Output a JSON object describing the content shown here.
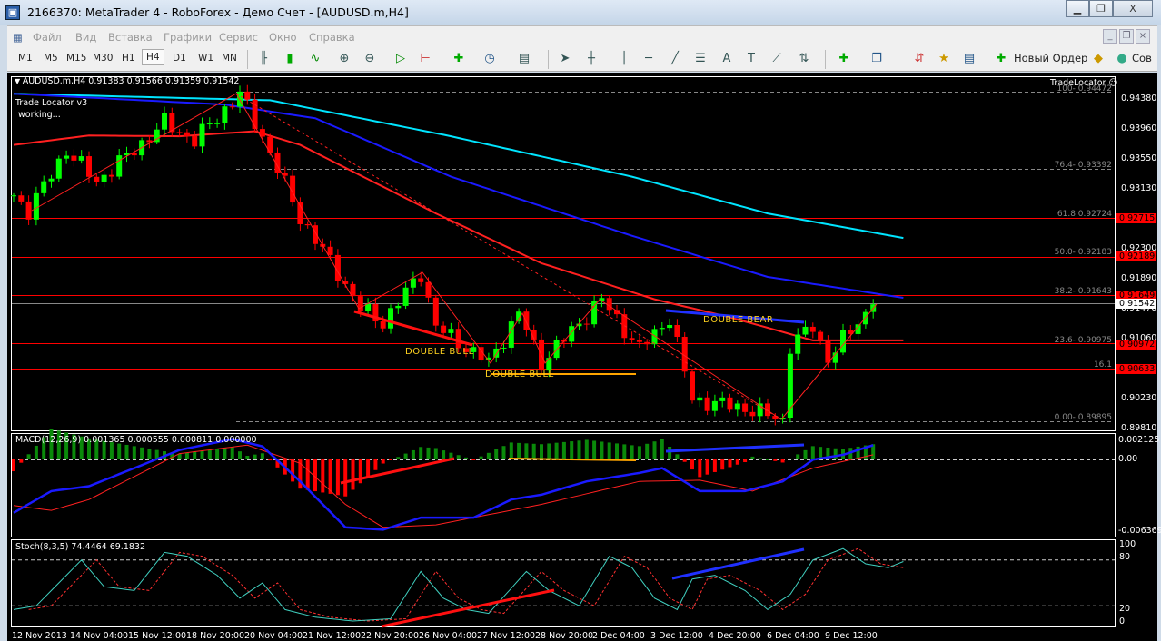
{
  "window": {
    "title": "2166370: MetaTrader 4 - RoboForex - Демо Счет - [AUDUSD.m,H4]",
    "minimize": "▁",
    "restore": "❐",
    "close": "X"
  },
  "menu": [
    "Файл",
    "Вид",
    "Вставка",
    "Графики",
    "Сервис",
    "Окно",
    "Справка"
  ],
  "toolbar": {
    "timeframes": [
      "M1",
      "M5",
      "M15",
      "M30",
      "H1",
      "H4",
      "D1",
      "W1",
      "MN"
    ],
    "selected_timeframe": "H4",
    "new_order": "Новый Ордер",
    "advisors": "Сов"
  },
  "chart": {
    "header": "AUDUSD.m,H4  0.91383 0.91566 0.91359 0.91542",
    "indicator_name": "Trade Locator v3",
    "indicator_status": "working...",
    "trade_locator_label": "TradeLocator ☺",
    "price_ticks": [
      "0.94380",
      "0.93960",
      "0.93550",
      "0.93130",
      "0.92300",
      "0.91890",
      "0.91470",
      "0.91060",
      "0.90230",
      "0.89810"
    ],
    "price_tags": [
      {
        "value": "0.92715",
        "color": "#ff0000"
      },
      {
        "value": "0.92189",
        "color": "#ff0000"
      },
      {
        "value": "0.91649",
        "color": "#ff0000"
      },
      {
        "value": "0.90972",
        "color": "#ff0000"
      },
      {
        "value": "0.90633",
        "color": "#ff0000"
      }
    ],
    "current_price": "0.91542",
    "fibo": [
      {
        "label": "100- 0.94472",
        "price": 0.94472,
        "style": "dash"
      },
      {
        "label": "76.4- 0.93392",
        "price": 0.93392,
        "style": "dash"
      },
      {
        "label": "61.8 0.92724",
        "price": 0.92724,
        "style": "red"
      },
      {
        "label": "50.0- 0.92183",
        "price": 0.92183,
        "style": "red"
      },
      {
        "label": "38.2- 0.91643",
        "price": 0.91643,
        "style": "red"
      },
      {
        "label": "23.6- 0.90975",
        "price": 0.90975,
        "style": "red"
      },
      {
        "label": "16.1",
        "price": 0.90633,
        "style": "red"
      },
      {
        "label": "0.00- 0.89895",
        "price": 0.89895,
        "style": "dash"
      }
    ],
    "annotations": [
      "DOUBLE BULL",
      "DOUBLE BULL",
      "DOUBLE BEAR"
    ],
    "time_labels": [
      "12 Nov 2013",
      "14 Nov 04:00",
      "15 Nov 12:00",
      "18 Nov 20:00",
      "20 Nov 04:00",
      "21 Nov 12:00",
      "22 Nov 20:00",
      "26 Nov 04:00",
      "27 Nov 12:00",
      "28 Nov 20:00",
      "2 Dec 04:00",
      "3 Dec 12:00",
      "4 Dec 20:00",
      "6 Dec 04:00",
      "9 Dec 12:00"
    ],
    "macd": {
      "header": "MACD(12,26,9) 0.001365 0.000555 0.000811 0.000000",
      "ticks": [
        "0.002125",
        "0.00",
        "-0.006369"
      ]
    },
    "stoch": {
      "header": "Stoch(8,3,5) 74.4464 69.1832",
      "ticks": [
        "100",
        "80",
        "20",
        "0"
      ]
    },
    "colors": {
      "bull": "#00ff00",
      "bear": "#ff0000",
      "ma_fast": "#ff2020",
      "ma_mid": "#1a1aff",
      "ma_slow": "#00e5ff",
      "annotation": "#ffd21f"
    }
  },
  "chart_data": {
    "type": "candlestick",
    "symbol": "AUDUSD.m",
    "timeframe": "H4",
    "price_path": [
      [
        0,
        0.9303
      ],
      [
        2,
        0.9282
      ],
      [
        7,
        0.9366
      ],
      [
        11,
        0.9322
      ],
      [
        16,
        0.9366
      ],
      [
        20,
        0.9404
      ],
      [
        24,
        0.9379
      ],
      [
        30,
        0.9444
      ],
      [
        33,
        0.9385
      ],
      [
        38,
        0.9272
      ],
      [
        43,
        0.9196
      ],
      [
        46,
        0.9146
      ],
      [
        49,
        0.9127
      ],
      [
        54,
        0.9196
      ],
      [
        56,
        0.9121
      ],
      [
        63,
        0.9071
      ],
      [
        67,
        0.914
      ],
      [
        70,
        0.9071
      ],
      [
        78,
        0.9159
      ],
      [
        83,
        0.909
      ],
      [
        87,
        0.9134
      ],
      [
        90,
        0.902
      ],
      [
        97,
        0.9008
      ],
      [
        102,
        0.8992
      ],
      [
        103,
        0.9095
      ],
      [
        106,
        0.9121
      ],
      [
        108,
        0.9077
      ],
      [
        114,
        0.9152
      ]
    ],
    "ma_fast": [
      [
        0,
        0.9373
      ],
      [
        10,
        0.9386
      ],
      [
        22,
        0.9385
      ],
      [
        32,
        0.9392
      ],
      [
        38,
        0.9373
      ],
      [
        56,
        0.9278
      ],
      [
        70,
        0.9209
      ],
      [
        85,
        0.9159
      ],
      [
        95,
        0.9134
      ],
      [
        106,
        0.9102
      ],
      [
        118,
        0.9102
      ]
    ],
    "ma_mid": [
      [
        0,
        0.9444
      ],
      [
        28,
        0.9429
      ],
      [
        40,
        0.941
      ],
      [
        58,
        0.9329
      ],
      [
        82,
        0.9247
      ],
      [
        100,
        0.919
      ],
      [
        118,
        0.9161
      ]
    ],
    "ma_slow": [
      [
        0,
        0.9444
      ],
      [
        34,
        0.9435
      ],
      [
        58,
        0.9385
      ],
      [
        82,
        0.9329
      ],
      [
        100,
        0.9278
      ],
      [
        118,
        0.9244
      ]
    ],
    "macd_main": [
      [
        0,
        -0.0044
      ],
      [
        5,
        -0.0026
      ],
      [
        10,
        -0.0022
      ],
      [
        16,
        -0.0007
      ],
      [
        22,
        0.0008
      ],
      [
        29,
        0.0017
      ],
      [
        33,
        0.0011
      ],
      [
        38,
        -0.0018
      ],
      [
        44,
        -0.0056
      ],
      [
        49,
        -0.0058
      ],
      [
        54,
        -0.0048
      ],
      [
        61,
        -0.0048
      ],
      [
        66,
        -0.0033
      ],
      [
        70,
        -0.0029
      ],
      [
        76,
        -0.0018
      ],
      [
        83,
        -0.0011
      ],
      [
        86,
        -0.0007
      ],
      [
        91,
        -0.0026
      ],
      [
        97,
        -0.0026
      ],
      [
        102,
        -0.0018
      ],
      [
        106,
        0.0
      ],
      [
        110,
        0.0004
      ],
      [
        114,
        0.0012
      ]
    ],
    "macd_signal": [
      [
        0,
        -0.0038
      ],
      [
        5,
        -0.0042
      ],
      [
        10,
        -0.0033
      ],
      [
        22,
        0.0005
      ],
      [
        31,
        0.0012
      ],
      [
        38,
        -0.0003
      ],
      [
        44,
        -0.0037
      ],
      [
        49,
        -0.0056
      ],
      [
        56,
        -0.0054
      ],
      [
        70,
        -0.0037
      ],
      [
        83,
        -0.0018
      ],
      [
        91,
        -0.0017
      ],
      [
        98,
        -0.0026
      ],
      [
        106,
        -0.0007
      ],
      [
        114,
        0.0004
      ]
    ],
    "stoch_main": [
      [
        0,
        15
      ],
      [
        3,
        20
      ],
      [
        7,
        60
      ],
      [
        9,
        80
      ],
      [
        12,
        45
      ],
      [
        16,
        40
      ],
      [
        20,
        90
      ],
      [
        23,
        85
      ],
      [
        27,
        60
      ],
      [
        30,
        30
      ],
      [
        33,
        50
      ],
      [
        36,
        15
      ],
      [
        40,
        5
      ],
      [
        45,
        0
      ],
      [
        50,
        3
      ],
      [
        54,
        65
      ],
      [
        57,
        30
      ],
      [
        60,
        15
      ],
      [
        63,
        10
      ],
      [
        68,
        65
      ],
      [
        71,
        40
      ],
      [
        75,
        20
      ],
      [
        79,
        85
      ],
      [
        82,
        70
      ],
      [
        85,
        30
      ],
      [
        88,
        15
      ],
      [
        90,
        55
      ],
      [
        93,
        60
      ],
      [
        97,
        40
      ],
      [
        100,
        15
      ],
      [
        103,
        35
      ],
      [
        106,
        80
      ],
      [
        110,
        95
      ],
      [
        113,
        75
      ],
      [
        116,
        70
      ],
      [
        118,
        78
      ]
    ],
    "y_range": [
      0.8981,
      0.9438
    ],
    "macd_range": [
      -0.006369,
      0.002125
    ],
    "stoch_range": [
      0,
      100
    ],
    "stoch_levels": [
      20,
      80
    ]
  }
}
